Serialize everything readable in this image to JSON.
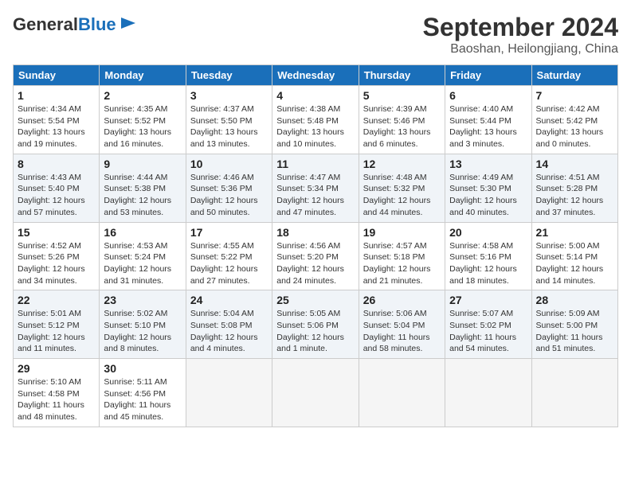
{
  "header": {
    "logo_general": "General",
    "logo_blue": "Blue",
    "month": "September 2024",
    "location": "Baoshan, Heilongjiang, China"
  },
  "weekdays": [
    "Sunday",
    "Monday",
    "Tuesday",
    "Wednesday",
    "Thursday",
    "Friday",
    "Saturday"
  ],
  "weeks": [
    [
      {
        "day": "1",
        "info": "Sunrise: 4:34 AM\nSunset: 5:54 PM\nDaylight: 13 hours and 19 minutes."
      },
      {
        "day": "2",
        "info": "Sunrise: 4:35 AM\nSunset: 5:52 PM\nDaylight: 13 hours and 16 minutes."
      },
      {
        "day": "3",
        "info": "Sunrise: 4:37 AM\nSunset: 5:50 PM\nDaylight: 13 hours and 13 minutes."
      },
      {
        "day": "4",
        "info": "Sunrise: 4:38 AM\nSunset: 5:48 PM\nDaylight: 13 hours and 10 minutes."
      },
      {
        "day": "5",
        "info": "Sunrise: 4:39 AM\nSunset: 5:46 PM\nDaylight: 13 hours and 6 minutes."
      },
      {
        "day": "6",
        "info": "Sunrise: 4:40 AM\nSunset: 5:44 PM\nDaylight: 13 hours and 3 minutes."
      },
      {
        "day": "7",
        "info": "Sunrise: 4:42 AM\nSunset: 5:42 PM\nDaylight: 13 hours and 0 minutes."
      }
    ],
    [
      {
        "day": "8",
        "info": "Sunrise: 4:43 AM\nSunset: 5:40 PM\nDaylight: 12 hours and 57 minutes."
      },
      {
        "day": "9",
        "info": "Sunrise: 4:44 AM\nSunset: 5:38 PM\nDaylight: 12 hours and 53 minutes."
      },
      {
        "day": "10",
        "info": "Sunrise: 4:46 AM\nSunset: 5:36 PM\nDaylight: 12 hours and 50 minutes."
      },
      {
        "day": "11",
        "info": "Sunrise: 4:47 AM\nSunset: 5:34 PM\nDaylight: 12 hours and 47 minutes."
      },
      {
        "day": "12",
        "info": "Sunrise: 4:48 AM\nSunset: 5:32 PM\nDaylight: 12 hours and 44 minutes."
      },
      {
        "day": "13",
        "info": "Sunrise: 4:49 AM\nSunset: 5:30 PM\nDaylight: 12 hours and 40 minutes."
      },
      {
        "day": "14",
        "info": "Sunrise: 4:51 AM\nSunset: 5:28 PM\nDaylight: 12 hours and 37 minutes."
      }
    ],
    [
      {
        "day": "15",
        "info": "Sunrise: 4:52 AM\nSunset: 5:26 PM\nDaylight: 12 hours and 34 minutes."
      },
      {
        "day": "16",
        "info": "Sunrise: 4:53 AM\nSunset: 5:24 PM\nDaylight: 12 hours and 31 minutes."
      },
      {
        "day": "17",
        "info": "Sunrise: 4:55 AM\nSunset: 5:22 PM\nDaylight: 12 hours and 27 minutes."
      },
      {
        "day": "18",
        "info": "Sunrise: 4:56 AM\nSunset: 5:20 PM\nDaylight: 12 hours and 24 minutes."
      },
      {
        "day": "19",
        "info": "Sunrise: 4:57 AM\nSunset: 5:18 PM\nDaylight: 12 hours and 21 minutes."
      },
      {
        "day": "20",
        "info": "Sunrise: 4:58 AM\nSunset: 5:16 PM\nDaylight: 12 hours and 18 minutes."
      },
      {
        "day": "21",
        "info": "Sunrise: 5:00 AM\nSunset: 5:14 PM\nDaylight: 12 hours and 14 minutes."
      }
    ],
    [
      {
        "day": "22",
        "info": "Sunrise: 5:01 AM\nSunset: 5:12 PM\nDaylight: 12 hours and 11 minutes."
      },
      {
        "day": "23",
        "info": "Sunrise: 5:02 AM\nSunset: 5:10 PM\nDaylight: 12 hours and 8 minutes."
      },
      {
        "day": "24",
        "info": "Sunrise: 5:04 AM\nSunset: 5:08 PM\nDaylight: 12 hours and 4 minutes."
      },
      {
        "day": "25",
        "info": "Sunrise: 5:05 AM\nSunset: 5:06 PM\nDaylight: 12 hours and 1 minute."
      },
      {
        "day": "26",
        "info": "Sunrise: 5:06 AM\nSunset: 5:04 PM\nDaylight: 11 hours and 58 minutes."
      },
      {
        "day": "27",
        "info": "Sunrise: 5:07 AM\nSunset: 5:02 PM\nDaylight: 11 hours and 54 minutes."
      },
      {
        "day": "28",
        "info": "Sunrise: 5:09 AM\nSunset: 5:00 PM\nDaylight: 11 hours and 51 minutes."
      }
    ],
    [
      {
        "day": "29",
        "info": "Sunrise: 5:10 AM\nSunset: 4:58 PM\nDaylight: 11 hours and 48 minutes."
      },
      {
        "day": "30",
        "info": "Sunrise: 5:11 AM\nSunset: 4:56 PM\nDaylight: 11 hours and 45 minutes."
      },
      null,
      null,
      null,
      null,
      null
    ]
  ]
}
